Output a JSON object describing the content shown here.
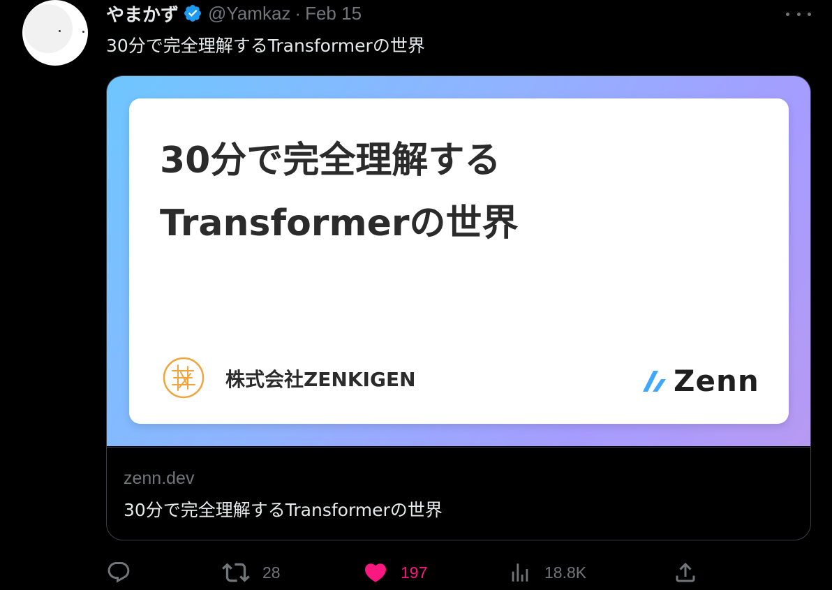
{
  "author": {
    "display_name": "やまかず",
    "handle": "@Yamkaz",
    "separator": "·",
    "date": "Feb 15"
  },
  "tweet": {
    "text": "30分で完全理解するTransformerの世界"
  },
  "card": {
    "image": {
      "title_line1": "30分で完全理解する",
      "title_line2": "Transformerの世界",
      "org_name": "株式会社ZENKIGEN",
      "brand": "Zenn"
    },
    "domain": "zenn.dev",
    "title": "30分で完全理解するTransformerの世界"
  },
  "actions": {
    "reply_count": "",
    "retweet_count": "28",
    "like_count": "197",
    "views_count": "18.8K"
  },
  "colors": {
    "verified": "#1d9bf0",
    "like": "#f91880",
    "muted": "#71767b",
    "zenn_blue": "#3ea8ff",
    "org_logo": "#f2a33a"
  },
  "icons": [
    "more-icon",
    "verified-badge-icon",
    "reply-icon",
    "retweet-icon",
    "heart-icon",
    "views-icon",
    "share-icon"
  ]
}
